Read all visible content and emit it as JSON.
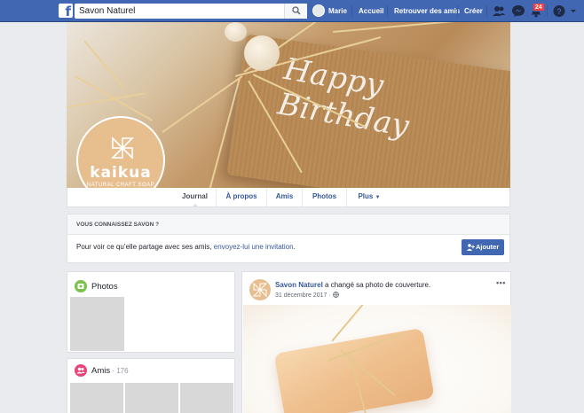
{
  "topbar": {
    "search_value": "Savon Naturel",
    "user_name": "Marie",
    "links": [
      "Accueil",
      "Retrouver des amis",
      "Créer"
    ],
    "notification_count": "24",
    "icons": [
      "facebook-logo-icon",
      "search-icon",
      "friend-requests-icon",
      "messenger-icon",
      "notifications-icon",
      "help-icon"
    ]
  },
  "profile": {
    "brand_name": "kaikua",
    "brand_tagline": "NATURAL CRAFT SOAP",
    "cover_text": "Happy Birthday"
  },
  "tabs": [
    {
      "label": "Journal",
      "active": true
    },
    {
      "label": "À propos",
      "active": false
    },
    {
      "label": "Amis",
      "active": false
    },
    {
      "label": "Photos",
      "active": false
    },
    {
      "label": "Plus",
      "active": false
    }
  ],
  "suggest": {
    "title": "VOUS CONNAISSEZ SAVON ?",
    "text": "Pour voir ce qu’elle partage avec ses amis, ",
    "link": "envoyez-lui une invitation",
    "text_end": ".",
    "button": "Ajouter"
  },
  "photos_card": {
    "title": "Photos"
  },
  "amis_card": {
    "title": "Amis",
    "count": " · 176"
  },
  "post": {
    "author": "Savon Naturel",
    "action": " a changé sa photo de couverture.",
    "date": "31 décembre 2017 · ",
    "menu": "•••"
  },
  "colors": {
    "facebook_blue": "#4267b2",
    "link_blue": "#365899",
    "brand_peach": "#e7bf8f",
    "badge_red": "#fa3e3e"
  }
}
